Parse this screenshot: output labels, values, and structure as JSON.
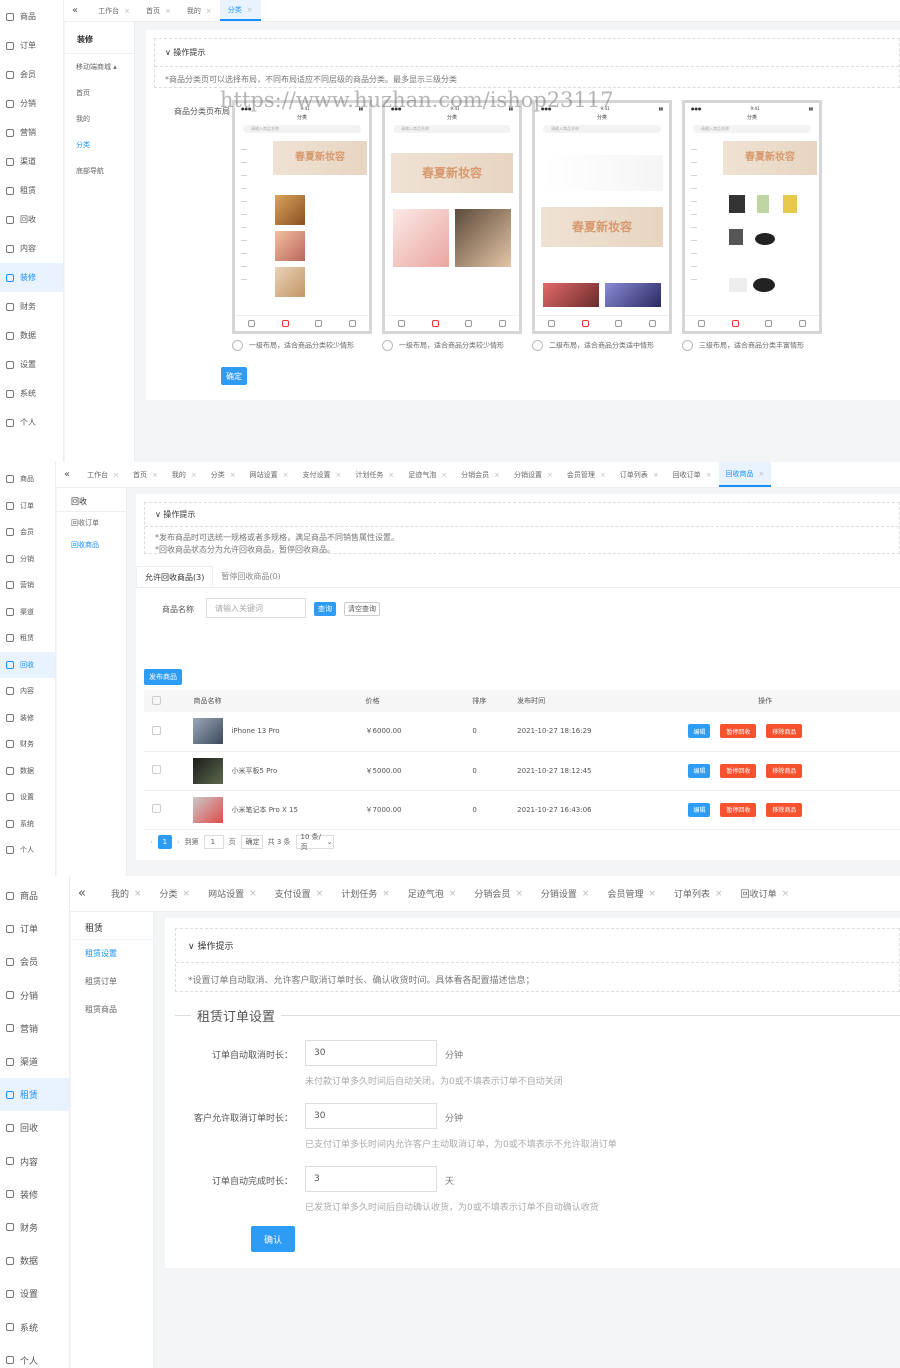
{
  "watermark": "https://www.huzhan.com/ishop23117",
  "sidebar1": [
    "商品",
    "订单",
    "会员",
    "分销",
    "营销",
    "渠道",
    "租赁",
    "回收",
    "内容",
    "装修",
    "财务",
    "数据",
    "设置",
    "系统",
    "个人"
  ],
  "sidebar1_active": "装修",
  "panel1": {
    "tabs": [
      {
        "label": "工作台"
      },
      {
        "label": "首页"
      },
      {
        "label": "我的"
      },
      {
        "label": "分类",
        "active": true
      }
    ],
    "sub_title": "装修",
    "sub_items": [
      {
        "label": "移动端商城 ▴",
        "on": false
      },
      {
        "label": "首页",
        "on": false
      },
      {
        "label": "我的",
        "on": false
      },
      {
        "label": "分类",
        "on": true
      },
      {
        "label": "底部导航",
        "on": false
      }
    ],
    "tip_head": "操作提示",
    "tip_text": "*商品分类页可以选择布局，不同布局适应不同层级的商品分类。最多显示三级分类",
    "layout_label": "商品分类页布局",
    "phone_banner": "春夏新妆容",
    "phone_title": "分类",
    "phone_search": "请输入商品名称",
    "options": [
      "一级布局，适合商品分类较少情形",
      "一级布局，适合商品分类较少情形",
      "二级布局，适合商品分类适中情形",
      "三级布局，适合商品分类丰富情形"
    ],
    "confirm": "确定"
  },
  "sidebar2_active": "回收",
  "panel2": {
    "tabs": [
      {
        "label": "工作台"
      },
      {
        "label": "首页"
      },
      {
        "label": "我的"
      },
      {
        "label": "分类"
      },
      {
        "label": "网站设置"
      },
      {
        "label": "支付设置"
      },
      {
        "label": "计划任务"
      },
      {
        "label": "足迹气泡"
      },
      {
        "label": "分销会员"
      },
      {
        "label": "分销设置"
      },
      {
        "label": "会员管理"
      },
      {
        "label": "订单列表"
      },
      {
        "label": "回收订单"
      },
      {
        "label": "回收商品",
        "active": true
      }
    ],
    "sub_title": "回收",
    "sub_items": [
      {
        "label": "回收订单",
        "on": false
      },
      {
        "label": "回收商品",
        "on": true
      }
    ],
    "tip_head": "操作提示",
    "tip_lines": [
      "*发布商品时可选统一规格或者多规格，满足商品不同销售属性设置。",
      "*回收商品状态分为允许回收商品，暂停回收商品。"
    ],
    "subtabs": [
      {
        "label": "允许回收商品(3)",
        "active": true
      },
      {
        "label": "暂停回收商品(0)",
        "active": false
      }
    ],
    "search_label": "商品名称",
    "search_placeholder": "请输入关键词",
    "query_btn": "查询",
    "reset_btn": "清空查询",
    "publish_btn": "发布商品",
    "columns": [
      "商品名称",
      "价格",
      "排序",
      "发布时间",
      "操作"
    ],
    "rows": [
      {
        "name": "iPhone 13 Pro",
        "price": "￥6000.00",
        "sort": "0",
        "time": "2021-10-27 18:16:29"
      },
      {
        "name": "小米平板5 Pro",
        "price": "￥5000.00",
        "sort": "0",
        "time": "2021-10-27 18:12:45"
      },
      {
        "name": "小米笔记本 Pro X 15",
        "price": "￥7000.00",
        "sort": "0",
        "time": "2021-10-27 16:43:06"
      }
    ],
    "actions": [
      "编辑",
      "暂停回收",
      "移除商品"
    ],
    "pager": {
      "page": "1",
      "goto": "到第",
      "page_input": "1",
      "unit": "页",
      "confirm": "确定",
      "total": "共 3 条",
      "size": "10 条/页"
    }
  },
  "sidebar3_active": "租赁",
  "panel3": {
    "tabs": [
      {
        "label": "我的"
      },
      {
        "label": "分类"
      },
      {
        "label": "网站设置"
      },
      {
        "label": "支付设置"
      },
      {
        "label": "计划任务"
      },
      {
        "label": "足迹气泡"
      },
      {
        "label": "分销会员"
      },
      {
        "label": "分销设置"
      },
      {
        "label": "会员管理"
      },
      {
        "label": "订单列表"
      },
      {
        "label": "回收订单"
      }
    ],
    "sub_title": "租赁",
    "sub_items": [
      {
        "label": "租赁设置",
        "on": true
      },
      {
        "label": "租赁订单",
        "on": false
      },
      {
        "label": "租赁商品",
        "on": false
      }
    ],
    "tip_head": "操作提示",
    "tip_text": "*设置订单自动取消、允许客户取消订单时长、确认收货时间。具体看各配置描述信息；",
    "section_title": "租赁订单设置",
    "fields": [
      {
        "label": "订单自动取消时长：",
        "value": "30",
        "unit": "分钟",
        "hint": "未付款订单多久时间后自动关闭，为0或不填表示订单不自动关闭"
      },
      {
        "label": "客户允许取消订单时长：",
        "value": "30",
        "unit": "分钟",
        "hint": "已支付订单多长时间内允许客户主动取消订单，为0或不填表示不允许取消订单"
      },
      {
        "label": "订单自动完成时长：",
        "value": "3",
        "unit": "天",
        "hint": "已发货订单多久时间后自动确认收货，为0或不填表示订单不自动确认收货"
      }
    ],
    "confirm": "确认"
  },
  "colors": {
    "primary": "#1890ff",
    "button_blue": "#2d9cf4",
    "button_red": "#f5522d"
  }
}
